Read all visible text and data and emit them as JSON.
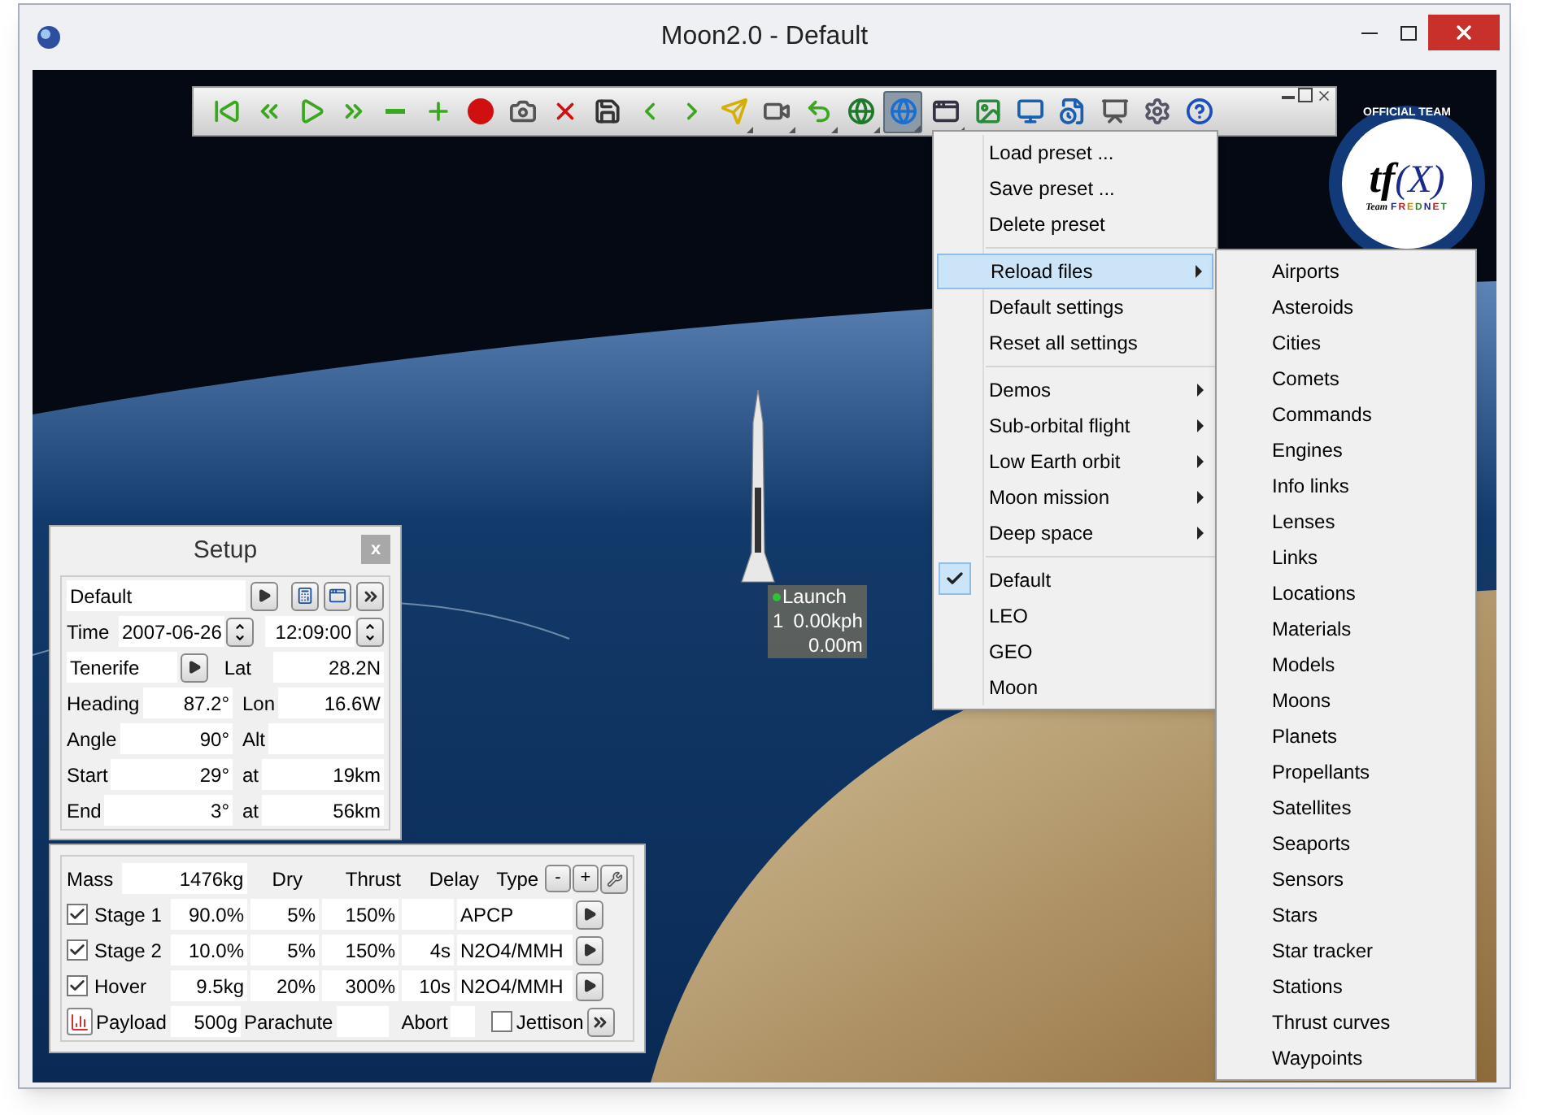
{
  "window": {
    "title": "Moon2.0 - Default"
  },
  "toolbar": {
    "buttons": [
      {
        "kind": "first",
        "selected": false,
        "dropdown": false
      },
      {
        "kind": "rewind",
        "selected": false,
        "dropdown": false
      },
      {
        "kind": "play",
        "selected": false,
        "dropdown": false
      },
      {
        "kind": "forward",
        "selected": false,
        "dropdown": false
      },
      {
        "kind": "minus",
        "selected": false,
        "dropdown": false
      },
      {
        "kind": "plus",
        "selected": false,
        "dropdown": false
      },
      {
        "kind": "record",
        "selected": false,
        "dropdown": false
      },
      {
        "kind": "camera",
        "selected": false,
        "dropdown": false
      },
      {
        "kind": "delete",
        "selected": false,
        "dropdown": false
      },
      {
        "kind": "save",
        "selected": false,
        "dropdown": false
      },
      {
        "kind": "prev",
        "selected": false,
        "dropdown": false
      },
      {
        "kind": "next",
        "selected": false,
        "dropdown": false
      },
      {
        "kind": "plane",
        "selected": false,
        "dropdown": true
      },
      {
        "kind": "video",
        "selected": false,
        "dropdown": true
      },
      {
        "kind": "undo",
        "selected": false,
        "dropdown": true
      },
      {
        "kind": "globe-up",
        "selected": false,
        "dropdown": true
      },
      {
        "kind": "globe",
        "selected": true,
        "dropdown": true
      },
      {
        "kind": "windows",
        "selected": false,
        "dropdown": true
      },
      {
        "kind": "picture",
        "selected": false,
        "dropdown": false
      },
      {
        "kind": "screen",
        "selected": false,
        "dropdown": false
      },
      {
        "kind": "document",
        "selected": false,
        "dropdown": false
      },
      {
        "kind": "board",
        "selected": false,
        "dropdown": false
      },
      {
        "kind": "settings",
        "selected": false,
        "dropdown": false
      },
      {
        "kind": "help",
        "selected": false,
        "dropdown": false
      }
    ]
  },
  "logo": {
    "arc": "OFFICIAL TEAM",
    "mark": "tf",
    "formula": "(X)",
    "team": "Team",
    "name": "FREDNET"
  },
  "marker": {
    "name": "Launch",
    "count": "1",
    "speed": "0.00kph",
    "altitude": "0.00m"
  },
  "setup": {
    "title": "Setup",
    "close": "x",
    "preset": "Default",
    "time_label": "Time",
    "date": "2007-06-26",
    "clock": "12:09:00",
    "location": "Tenerife",
    "lat_label": "Lat",
    "lat": "28.2N",
    "rows": [
      {
        "label": "Heading",
        "value": "87.2°",
        "label2": "Lon",
        "value2": "16.6W"
      },
      {
        "label": "Angle",
        "value": "90°",
        "label2": "Alt"
      },
      {
        "label": "Start",
        "value": "29°",
        "label2": "at",
        "value2": "19km"
      },
      {
        "label": "End",
        "value": "3°",
        "label2": "at",
        "value2": "56km"
      }
    ]
  },
  "stages": {
    "mass_label": "Mass",
    "mass": "1476kg",
    "columns": [
      "Dry",
      "Thrust",
      "Delay",
      "Type"
    ],
    "buttons": [
      "-",
      "+"
    ],
    "rows": [
      {
        "checked": true,
        "name": "Stage 1",
        "share": "90.0%",
        "dry": "5%",
        "thrust": "150%",
        "type": "APCP"
      },
      {
        "checked": true,
        "name": "Stage 2",
        "share": "10.0%",
        "dry": "5%",
        "thrust": "150%",
        "delay": "4s",
        "type": "N2O4/MMH"
      },
      {
        "checked": true,
        "name": "Hover",
        "share": "9.5kg",
        "dry": "20%",
        "thrust": "300%",
        "delay": "10s",
        "type": "N2O4/MMH"
      }
    ],
    "payload_label": "Payload",
    "payload": "500g",
    "parachute_label": "Parachute",
    "abort_label": "Abort",
    "jettison": {
      "label": "Jettison",
      "checked": false
    }
  },
  "menu": {
    "items": [
      {
        "kind": "item",
        "label": "Load preset ...",
        "submenu": false,
        "checked": false,
        "highlighted": false
      },
      {
        "kind": "item",
        "label": "Save preset ...",
        "submenu": false,
        "checked": false,
        "highlighted": false
      },
      {
        "kind": "item",
        "label": "Delete preset",
        "submenu": false,
        "checked": false,
        "highlighted": false
      },
      {
        "kind": "separator"
      },
      {
        "kind": "item",
        "label": "Reload files",
        "submenu": true,
        "checked": false,
        "highlighted": true
      },
      {
        "kind": "item",
        "label": "Default settings",
        "submenu": false,
        "checked": false,
        "highlighted": false
      },
      {
        "kind": "item",
        "label": "Reset all settings",
        "submenu": false,
        "checked": false,
        "highlighted": false
      },
      {
        "kind": "separator"
      },
      {
        "kind": "item",
        "label": "Demos",
        "submenu": true,
        "checked": false,
        "highlighted": false
      },
      {
        "kind": "item",
        "label": "Sub-orbital flight",
        "submenu": true,
        "checked": false,
        "highlighted": false
      },
      {
        "kind": "item",
        "label": "Low Earth orbit",
        "submenu": true,
        "checked": false,
        "highlighted": false
      },
      {
        "kind": "item",
        "label": "Moon mission",
        "submenu": true,
        "checked": false,
        "highlighted": false
      },
      {
        "kind": "item",
        "label": "Deep space",
        "submenu": true,
        "checked": false,
        "highlighted": false
      },
      {
        "kind": "separator"
      },
      {
        "kind": "item",
        "label": "Default",
        "submenu": false,
        "checked": true,
        "highlighted": false
      },
      {
        "kind": "item",
        "label": "LEO",
        "submenu": false,
        "checked": false,
        "highlighted": false
      },
      {
        "kind": "item",
        "label": "GEO",
        "submenu": false,
        "checked": false,
        "highlighted": false
      },
      {
        "kind": "item",
        "label": "Moon",
        "submenu": false,
        "checked": false,
        "highlighted": false
      }
    ]
  },
  "submenu": {
    "items": [
      "Airports",
      "Asteroids",
      "Cities",
      "Comets",
      "Commands",
      "Engines",
      "Info links",
      "Lenses",
      "Links",
      "Locations",
      "Materials",
      "Models",
      "Moons",
      "Planets",
      "Propellants",
      "Satellites",
      "Seaports",
      "Sensors",
      "Stars",
      "Star tracker",
      "Stations",
      "Thrust curves",
      "Waypoints"
    ]
  }
}
